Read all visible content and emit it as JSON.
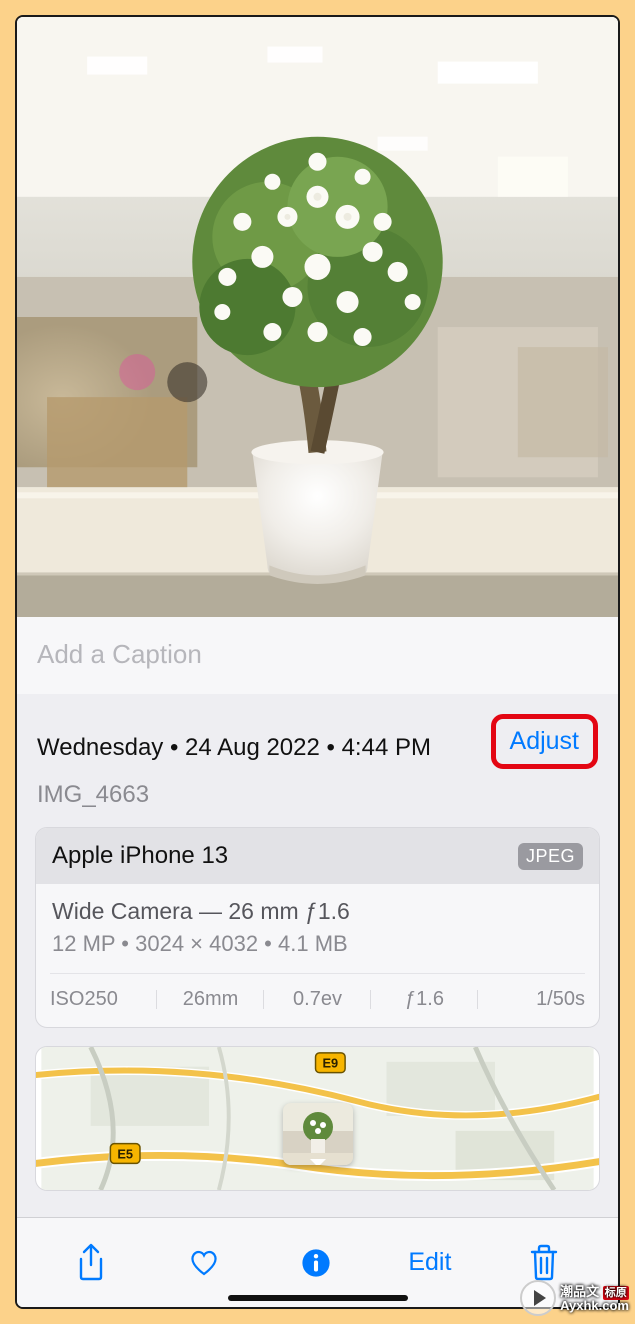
{
  "caption_placeholder": "Add a Caption",
  "date_line": "Wednesday • 24 Aug 2022 • 4:44 PM",
  "adjust_label": "Adjust",
  "filename": "IMG_4663",
  "device": "Apple iPhone 13",
  "format_badge": "JPEG",
  "lens_line": "Wide Camera — 26 mm ƒ1.6",
  "dims_line": "12 MP • 3024 × 4032 • 4.1 MB",
  "exif": {
    "iso": "ISO250",
    "focal": "26mm",
    "ev": "0.7ev",
    "aperture": "ƒ1.6",
    "shutter": "1/50s"
  },
  "map": {
    "road1": "E9",
    "road2": "E5"
  },
  "toolbar": {
    "edit_label": "Edit"
  },
  "watermark": {
    "line1": "潮品文",
    "line2": "Ayxhk.com",
    "badge": "标原"
  },
  "colors": {
    "accent": "#007aff",
    "highlight_border": "#e30613"
  }
}
